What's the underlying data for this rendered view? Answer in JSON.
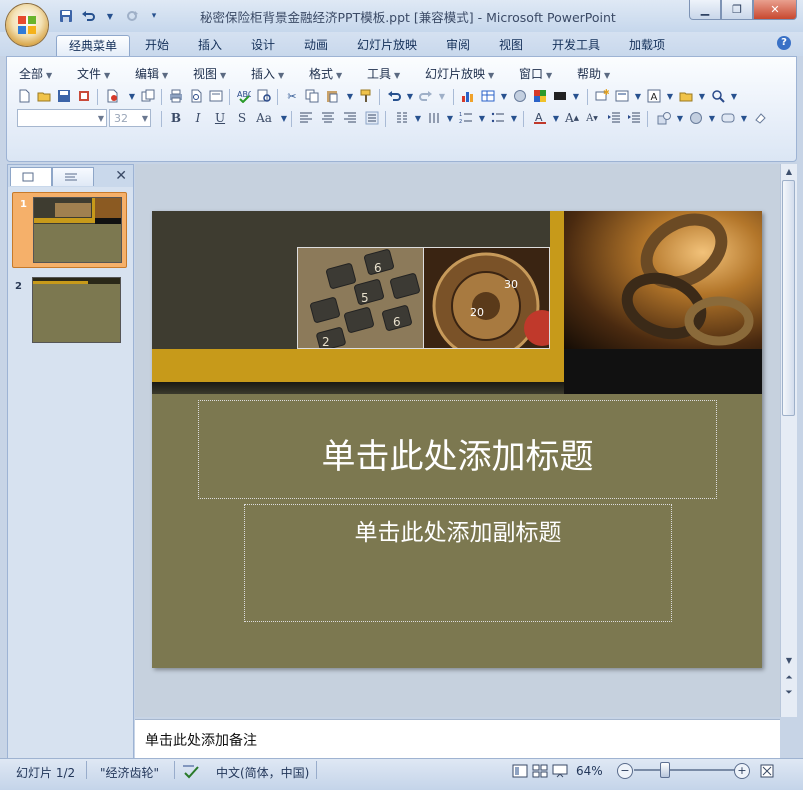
{
  "window": {
    "title": "秘密保险柜背景金融经济PPT模板.ppt [兼容模式] - Microsoft PowerPoint",
    "controls": [
      "minimize",
      "maximize",
      "close"
    ]
  },
  "quick_access": {
    "icons": [
      "save-icon",
      "undo-icon",
      "redo-icon",
      "customize-icon"
    ]
  },
  "ribbon_tabs": [
    {
      "label": "经典菜单",
      "active": true
    },
    {
      "label": "开始"
    },
    {
      "label": "插入"
    },
    {
      "label": "设计"
    },
    {
      "label": "动画"
    },
    {
      "label": "幻灯片放映"
    },
    {
      "label": "审阅"
    },
    {
      "label": "视图"
    },
    {
      "label": "开发工具"
    },
    {
      "label": "加载项"
    }
  ],
  "classic_menu": [
    {
      "label": "全部"
    },
    {
      "label": "文件"
    },
    {
      "label": "编辑"
    },
    {
      "label": "视图"
    },
    {
      "label": "插入"
    },
    {
      "label": "格式"
    },
    {
      "label": "工具"
    },
    {
      "label": "幻灯片放映"
    },
    {
      "label": "窗口"
    },
    {
      "label": "帮助"
    }
  ],
  "format_bar": {
    "font_name": "",
    "font_size": "32",
    "bold": "B",
    "italic": "I",
    "underline": "U",
    "shadow": "S",
    "case": "Aa"
  },
  "slides_pane": {
    "thumbnails": [
      {
        "number": "1",
        "selected": true
      },
      {
        "number": "2",
        "selected": false
      }
    ]
  },
  "slide": {
    "title_placeholder": "单击此处添加标题",
    "subtitle_placeholder": "单击此处添加副标题",
    "calculator_keys": [
      "6",
      "5",
      "6",
      "2"
    ],
    "dial_numbers": [
      "30",
      "20"
    ],
    "colors": {
      "background": "#7c7850",
      "top_band": "#3e3c30",
      "gold": "#c79a1a",
      "dark": "#111111"
    }
  },
  "notes": {
    "placeholder": "单击此处添加备注"
  },
  "status_bar": {
    "slide_counter": "幻灯片 1/2",
    "theme": "\"经济齿轮\"",
    "language": "中文(简体，中国)",
    "zoom": "64%",
    "zoom_minus": "−",
    "zoom_plus": "+"
  }
}
